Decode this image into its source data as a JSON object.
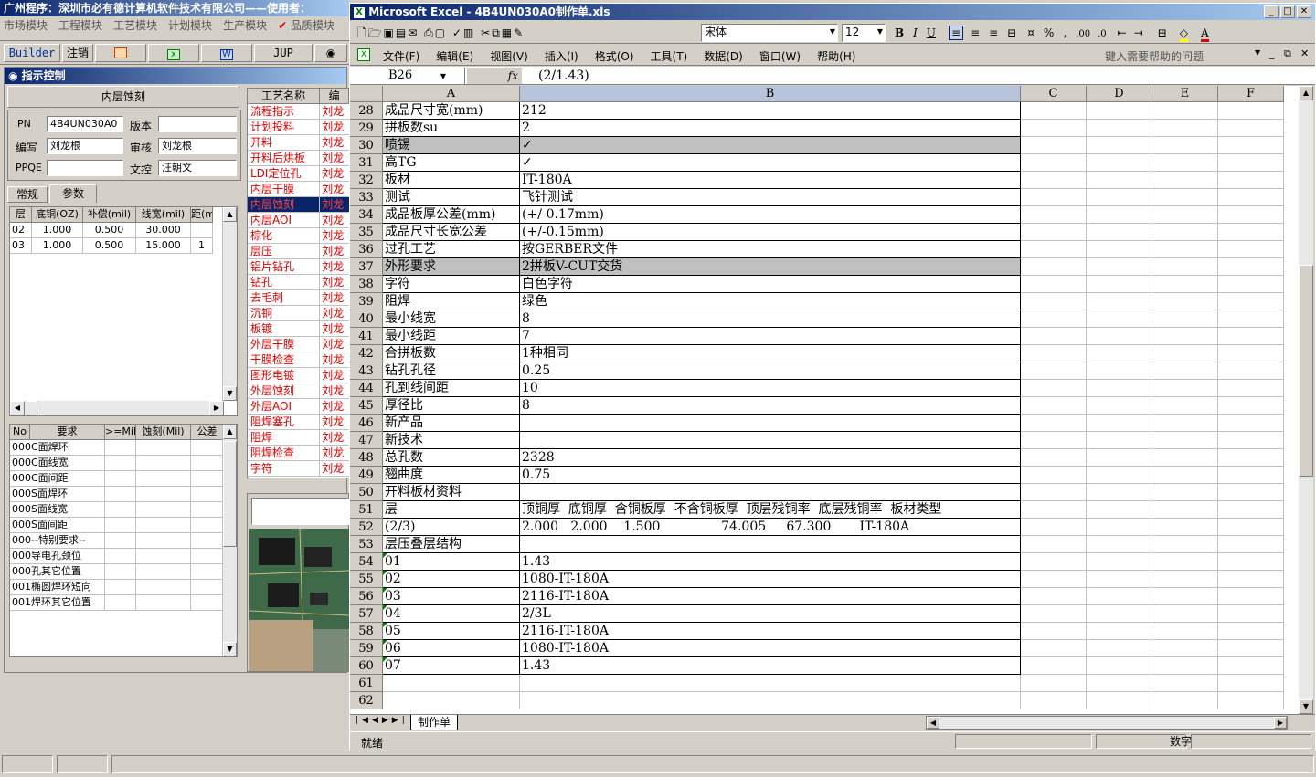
{
  "app": {
    "title": "广州程序：深圳市必有德计算机软件技术有限公司——使用者：",
    "menu": [
      "市场模块",
      "工程模块",
      "工艺模块",
      "计划模块",
      "生产模块",
      "品质模块"
    ]
  },
  "toolbar": {
    "builder": "Builder",
    "logout": "注销",
    "jup": "JUP"
  },
  "panel": {
    "title": "指示控制",
    "section": "内层蚀刻",
    "fields": {
      "pn_label": "PN",
      "pn_value": "4B4UN030A0",
      "version_label": "版本",
      "version_value": "",
      "writer_label": "编写",
      "writer_value": "刘龙根",
      "review_label": "审核",
      "review_value": "刘龙根",
      "ppqe_label": "PPQE",
      "ppqe_value": "",
      "doc_label": "文控",
      "doc_value": "汪朝文"
    },
    "tabs": [
      "常规",
      "参数"
    ],
    "layer_headers": [
      "层",
      "底铜(OZ)",
      "补偿(mil)",
      "线宽(mil)",
      "距(mi"
    ],
    "layer_rows": [
      [
        "02",
        "1.000",
        "0.500",
        "30.000",
        ""
      ],
      [
        "03",
        "1.000",
        "0.500",
        "15.000",
        "1"
      ]
    ],
    "req_headers": [
      "No",
      "要求",
      ">=Mil",
      "蚀刻(Mil)",
      "公差"
    ],
    "req_rows": [
      [
        "000",
        "C面焊环"
      ],
      [
        "000",
        "C面线宽"
      ],
      [
        "000",
        "C面间距"
      ],
      [
        "000",
        "S面焊环"
      ],
      [
        "000",
        "S面线宽"
      ],
      [
        "000",
        "S面间距"
      ],
      [
        "000",
        "--特别要求--"
      ],
      [
        "000",
        "导电孔颈位"
      ],
      [
        "000",
        "孔其它位置"
      ],
      [
        "001",
        "椭圆焊环短向"
      ],
      [
        "001",
        "焊环其它位置"
      ]
    ]
  },
  "process": {
    "headers": [
      "工艺名称",
      "编"
    ],
    "rows": [
      [
        "流程指示",
        "刘龙"
      ],
      [
        "计划投料",
        "刘龙"
      ],
      [
        "开料",
        "刘龙"
      ],
      [
        "开料后烘板",
        "刘龙"
      ],
      [
        "LDI定位孔",
        "刘龙"
      ],
      [
        "内层干膜",
        "刘龙"
      ],
      [
        "内层蚀刻",
        "刘龙"
      ],
      [
        "内层AOI",
        "刘龙"
      ],
      [
        "棕化",
        "刘龙"
      ],
      [
        "层压",
        "刘龙"
      ],
      [
        "铝片钻孔",
        "刘龙"
      ],
      [
        "钻孔",
        "刘龙"
      ],
      [
        "去毛刺",
        "刘龙"
      ],
      [
        "沉铜",
        "刘龙"
      ],
      [
        "板镀",
        "刘龙"
      ],
      [
        "外层干膜",
        "刘龙"
      ],
      [
        "干膜检查",
        "刘龙"
      ],
      [
        "图形电镀",
        "刘龙"
      ],
      [
        "外层蚀刻",
        "刘龙"
      ],
      [
        "外层AOI",
        "刘龙"
      ],
      [
        "阻焊塞孔",
        "刘龙"
      ],
      [
        "阻焊",
        "刘龙"
      ],
      [
        "阻焊检查",
        "刘龙"
      ],
      [
        "字符",
        "刘龙"
      ]
    ],
    "selected": 6
  },
  "excel": {
    "title": "Microsoft Excel - 4B4UN030A0制作单.xls",
    "font": "宋体",
    "size": "12",
    "menus": [
      "文件(F)",
      "编辑(E)",
      "视图(V)",
      "插入(I)",
      "格式(O)",
      "工具(T)",
      "数据(D)",
      "窗口(W)",
      "帮助(H)"
    ],
    "help_placeholder": "键入需要帮助的问题",
    "namebox": "B26",
    "formula": "(2/1.43)",
    "fx": "fx",
    "columns": [
      "A",
      "B",
      "C",
      "D",
      "E",
      "F"
    ],
    "rows": [
      [
        "28",
        "成品尺寸宽(mm)",
        "212"
      ],
      [
        "29",
        "拼板数su",
        "2"
      ],
      [
        "30",
        "喷锡",
        "✓"
      ],
      [
        "31",
        "高TG",
        "✓"
      ],
      [
        "32",
        "板材",
        "IT-180A"
      ],
      [
        "33",
        "测试",
        "飞针测试"
      ],
      [
        "34",
        "成品板厚公差(mm)",
        "(+/-0.17mm)"
      ],
      [
        "35",
        "成品尺寸长宽公差",
        "(+/-0.15mm)"
      ],
      [
        "36",
        "过孔工艺",
        "按GERBER文件"
      ],
      [
        "37",
        "外形要求",
        "2拼板V-CUT交货"
      ],
      [
        "38",
        "字符",
        "白色字符"
      ],
      [
        "39",
        "阻焊",
        "绿色"
      ],
      [
        "40",
        "最小线宽",
        "8"
      ],
      [
        "41",
        "最小线距",
        "7"
      ],
      [
        "42",
        "合拼板数",
        "1种相同"
      ],
      [
        "43",
        "钻孔孔径",
        "0.25"
      ],
      [
        "44",
        "孔到线间距",
        "10"
      ],
      [
        "45",
        "厚径比",
        "8"
      ],
      [
        "46",
        "新产品",
        ""
      ],
      [
        "47",
        "新技术",
        ""
      ],
      [
        "48",
        "总孔数",
        "2328"
      ],
      [
        "49",
        "翘曲度",
        "0.75"
      ],
      [
        "50",
        "开料板材资料",
        ""
      ],
      [
        "51",
        "层",
        "顶铜厚  底铜厚  含铜板厚  不含铜板厚  顶层残铜率  底层残铜率  板材类型"
      ],
      [
        "52",
        "(2/3)",
        "2.000   2.000    1.500               74.005     67.300       IT-180A"
      ],
      [
        "53",
        "层压叠层结构",
        ""
      ],
      [
        "54",
        "01",
        "1.43"
      ],
      [
        "55",
        "02",
        "1080-IT-180A"
      ],
      [
        "56",
        "03",
        "2116-IT-180A"
      ],
      [
        "57",
        "04",
        "2/3L"
      ],
      [
        "58",
        "05",
        "2116-IT-180A"
      ],
      [
        "59",
        "06",
        "1080-IT-180A"
      ],
      [
        "60",
        "07",
        "1.43"
      ],
      [
        "61",
        "",
        ""
      ],
      [
        "62",
        "",
        ""
      ]
    ],
    "sheet_tab": "制作单",
    "status_left": "就绪",
    "status_right": "数字"
  }
}
